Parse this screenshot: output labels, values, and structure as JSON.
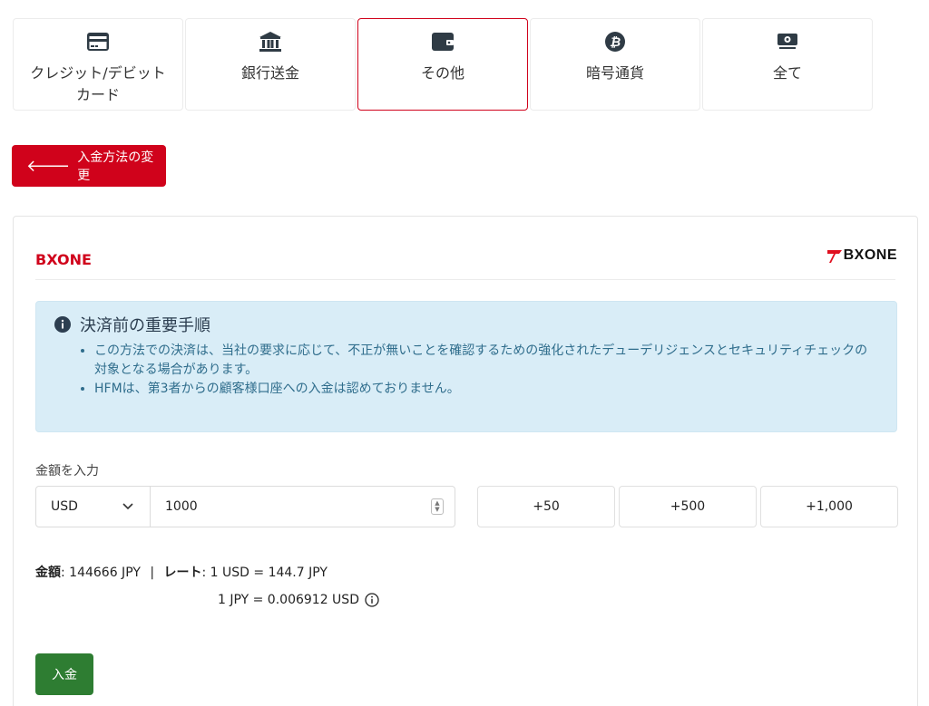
{
  "tabs": [
    {
      "label": "クレジット/デビットカード",
      "icon": "credit-card-icon",
      "active": false
    },
    {
      "label": "銀行送金",
      "icon": "bank-icon",
      "active": false
    },
    {
      "label": "その他",
      "icon": "wallet-icon",
      "active": true
    },
    {
      "label": "暗号通貨",
      "icon": "bitcoin-icon",
      "active": false
    },
    {
      "label": "全て",
      "icon": "money-icon",
      "active": false
    }
  ],
  "back_button": {
    "label": "入金方法の変更"
  },
  "card": {
    "title": "BXONE",
    "brand": "BXONE",
    "notice": {
      "title": "決済前の重要手順",
      "items": [
        "この方法での決済は、当社の要求に応じて、不正が無いことを確認するための強化されたデューデリジェンスとセキュリティチェックの対象となる場合があります。",
        "HFMは、第3者からの顧客様口座への入金は認めておりません。"
      ]
    },
    "amount_label": "金額を入力",
    "currency": "USD",
    "amount_value": "1000",
    "quick_amounts": [
      "+50",
      "+500",
      "+1,000"
    ],
    "summary": {
      "amount_label": "金額",
      "amount_value": ": 144666 JPY",
      "separator": "|",
      "rate_label": "レート",
      "rate_value": ": 1 USD = 144.7 JPY",
      "rate_inverse": "1 JPY = 0.006912 USD"
    },
    "submit_label": "入金"
  },
  "colors": {
    "accent": "#d0021b",
    "success": "#2e7d32",
    "notice_bg": "#d9edf7"
  }
}
